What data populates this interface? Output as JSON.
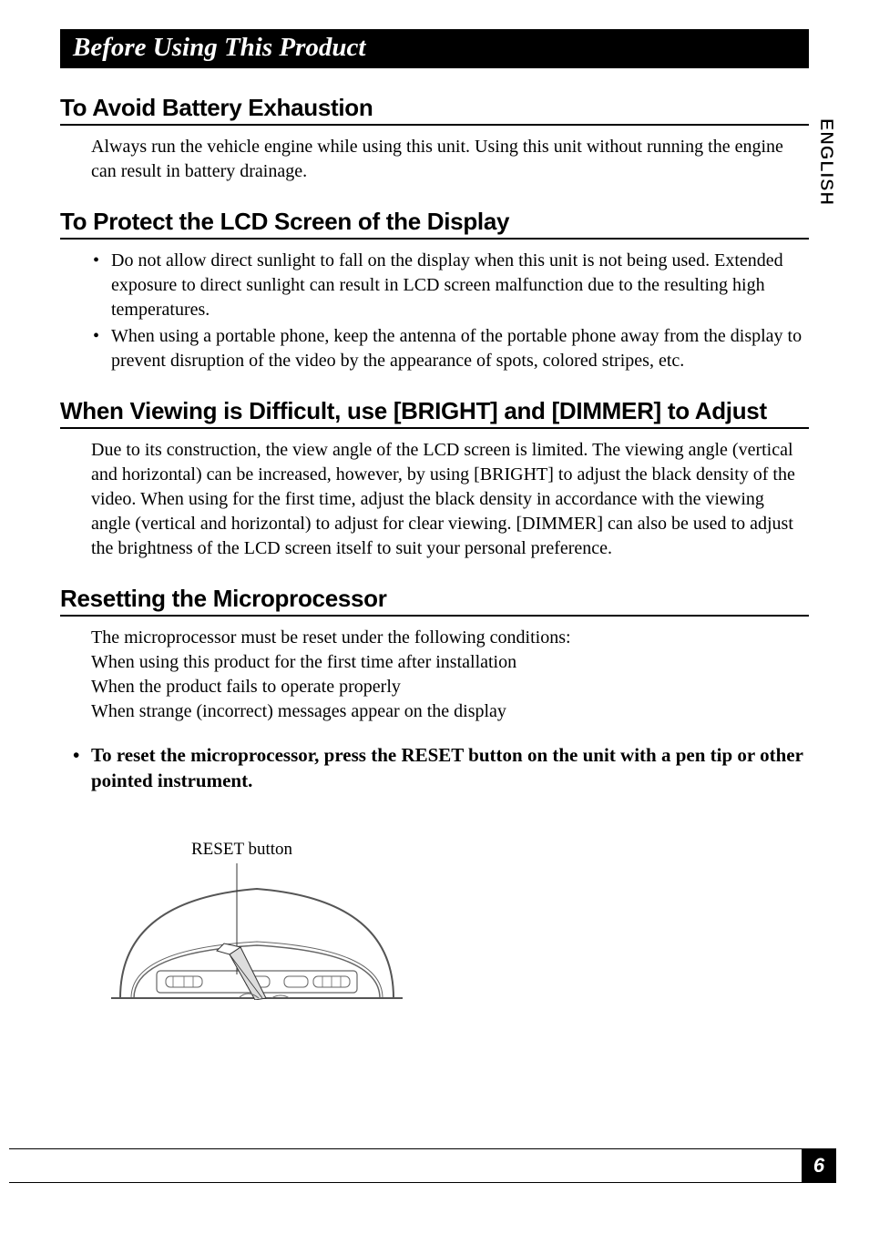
{
  "banner": {
    "title": "Before Using This Product"
  },
  "sideTab": "ENGLISH",
  "pageNumber": "6",
  "sections": {
    "battery": {
      "heading": "To Avoid Battery Exhaustion",
      "body": "Always run the vehicle engine while using this unit. Using this unit without running the engine can result in battery drainage."
    },
    "lcd": {
      "heading": "To Protect the LCD Screen of the Display",
      "bullets": [
        "Do not allow direct sunlight to fall on the display when this unit is not being used. Extended exposure to direct sunlight can result in LCD screen malfunction due to the resulting high temperatures.",
        "When using a portable phone, keep the antenna of the portable phone away from the display to prevent disruption of the video by the appearance of spots, colored stripes, etc."
      ]
    },
    "viewing": {
      "heading": "When Viewing is Difficult, use [BRIGHT] and [DIMMER] to Adjust",
      "body": "Due to its construction, the view angle of the LCD screen is limited. The viewing angle (vertical and horizontal) can be increased, however, by using [BRIGHT] to adjust the black density of the video. When using for the first time, adjust the black density in accordance with the viewing angle (vertical and horizontal) to adjust for clear viewing. [DIMMER] can also be used to adjust the brightness of the LCD screen itself to suit your personal preference."
    },
    "reset": {
      "heading": "Resetting the Microprocessor",
      "lines": [
        "The microprocessor must be reset under the following conditions:",
        "When using this product for the first time after installation",
        "When the product fails to operate properly",
        "When strange (incorrect) messages appear on the display"
      ],
      "instruction": "To reset the microprocessor, press the RESET button on the unit with a pen tip or other pointed instrument.",
      "figureLabel": "RESET button"
    }
  }
}
